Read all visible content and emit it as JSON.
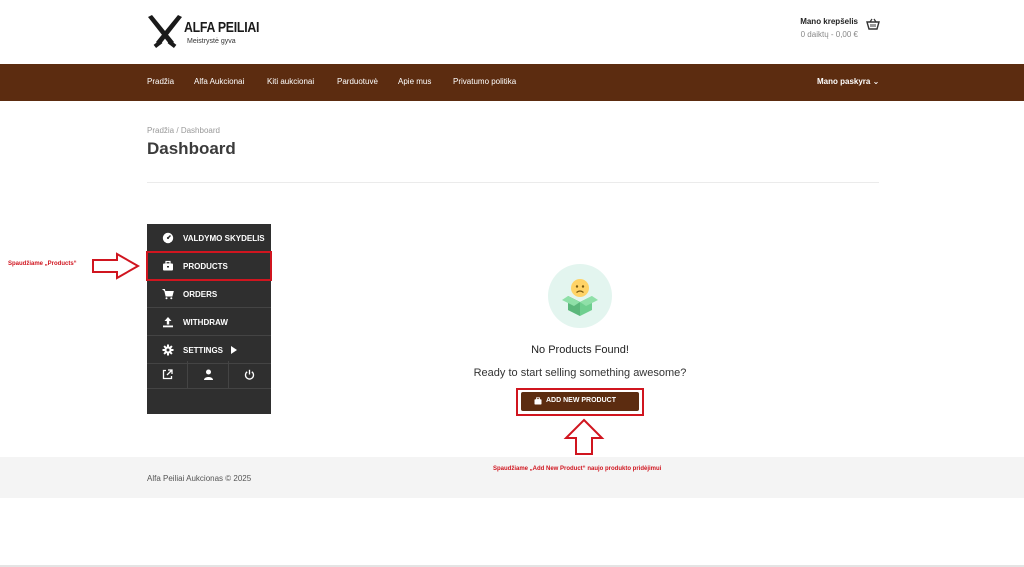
{
  "header": {
    "logo": {
      "name": "ALFA PEILIAI",
      "tagline": "Meistrystė gyva"
    },
    "cart": {
      "title": "Mano krepšelis",
      "summary": "0 daiktų - 0,00 €",
      "icon": "basket-icon"
    }
  },
  "nav": {
    "items": [
      {
        "label": "Pradžia"
      },
      {
        "label": "Alfa Aukcionai"
      },
      {
        "label": "Kiti aukcionai"
      },
      {
        "label": "Parduotuvė"
      },
      {
        "label": "Apie mus"
      },
      {
        "label": "Privatumo politika"
      }
    ],
    "account": "Mano paskyra ⌄"
  },
  "breadcrumb": {
    "home": "Pradžia",
    "separator": "/",
    "current": "Dashboard"
  },
  "page_title": "Dashboard",
  "side_menu": {
    "items": [
      {
        "label": "VALDYMO SKYDELIS",
        "icon": "dashboard-gauge-icon"
      },
      {
        "label": "PRODUCTS",
        "icon": "briefcase-icon"
      },
      {
        "label": "ORDERS",
        "icon": "cart-icon"
      },
      {
        "label": "WITHDRAW",
        "icon": "upload-icon"
      },
      {
        "label": "SETTINGS",
        "icon": "gear-icon"
      }
    ],
    "bottom_icons": [
      "external-link-icon",
      "user-icon",
      "power-icon"
    ]
  },
  "empty_state": {
    "icon": "sad-box-icon",
    "title": "No Products Found!",
    "subtitle": "Ready to start selling something awesome?",
    "button_label": "ADD NEW PRODUCT"
  },
  "annotations": {
    "left": "Spaudžiame „Products“",
    "bottom": "Spaudžiame „Add New Product“ naujo produkto pridėjimui",
    "color": "#d0151f"
  },
  "footer": {
    "text": "Alfa Peiliai Aukcionas © 2025"
  },
  "colors": {
    "brand_brown": "#5c2c10",
    "menu_dark": "#2f2f2f",
    "accent_mint": "#e3f5ef"
  }
}
